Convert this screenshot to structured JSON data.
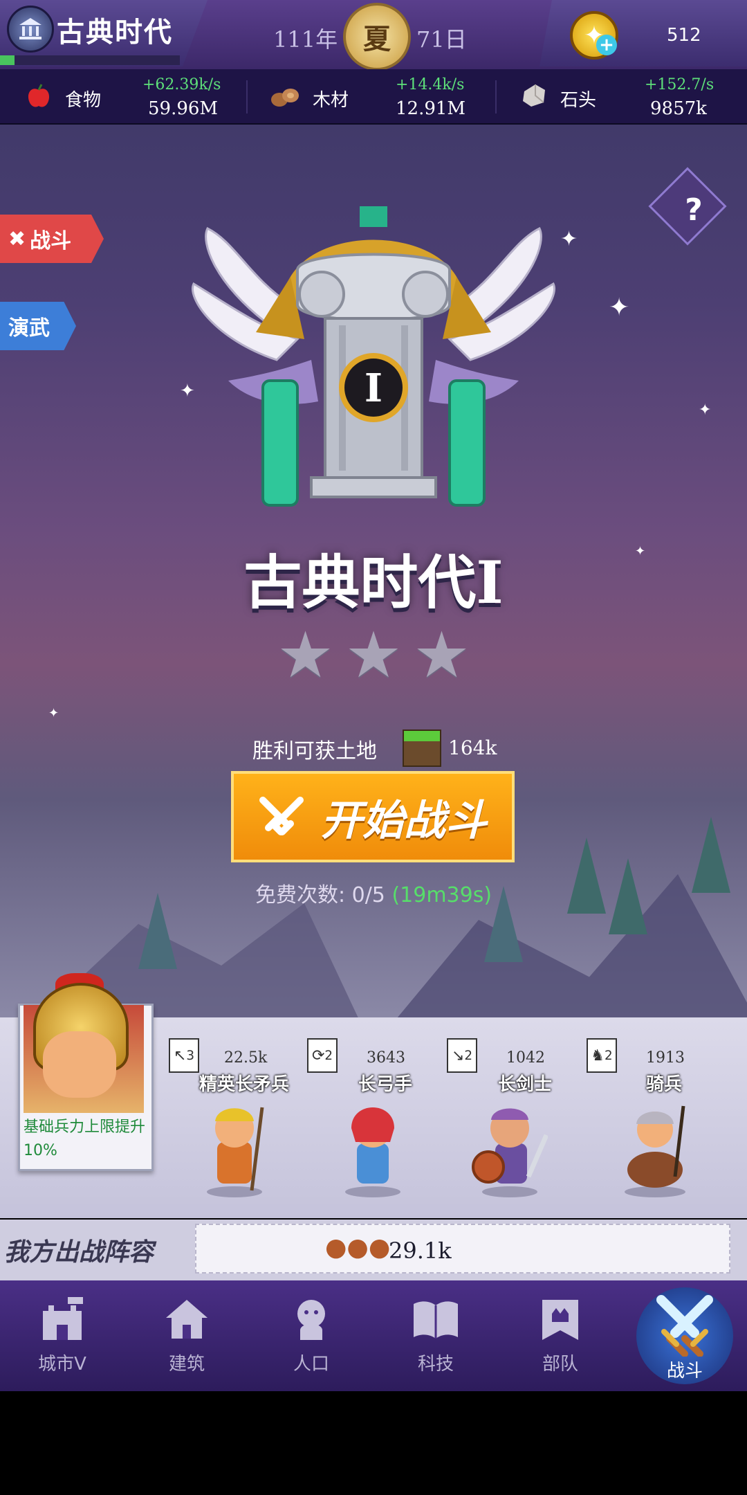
{
  "header": {
    "era_title": "古典时代",
    "year": "111年",
    "season": "夏",
    "day": "71日",
    "gold": "512",
    "era_progress": 0.08
  },
  "resources": [
    {
      "name": "食物",
      "rate": "+62.39k/s",
      "total": "59.96M",
      "icon": "apple-icon"
    },
    {
      "name": "木材",
      "rate": "+14.4k/s",
      "total": "12.91M",
      "icon": "wood-log-icon"
    },
    {
      "name": "石头",
      "rate": "+152.7/s",
      "total": "9857k",
      "icon": "stone-icon"
    }
  ],
  "side_buttons": {
    "battle": "战斗",
    "drill": "演武",
    "help": "?"
  },
  "stage": {
    "emblem_numeral": "I",
    "title": "古典时代I",
    "stars_earned": 0,
    "stars_total": 3,
    "reward_label": "胜利可获土地",
    "reward_value": "164k",
    "start_button": "开始战斗",
    "free_label": "免费次数:",
    "free_count": "0/5",
    "free_timer": "(19m39s)"
  },
  "hero": {
    "bonus_text": "基础兵力上限提升10%"
  },
  "units": [
    {
      "badge": "3",
      "count": "22.5k",
      "name": "精英长矛兵",
      "color": "#d9732c"
    },
    {
      "badge": "2",
      "count": "3643",
      "name": "长弓手",
      "color": "#d8343a"
    },
    {
      "badge": "2",
      "count": "1042",
      "name": "长剑士",
      "color": "#8f5bb0"
    },
    {
      "badge": "2",
      "count": "1913",
      "name": "骑兵",
      "color": "#8a4b2a"
    }
  ],
  "lineup": {
    "label": "我方出战阵容",
    "power": "29.1k"
  },
  "nav": [
    {
      "label": "城市V",
      "icon": "castle-icon"
    },
    {
      "label": "建筑",
      "icon": "house-icon"
    },
    {
      "label": "人口",
      "icon": "person-icon"
    },
    {
      "label": "科技",
      "icon": "book-icon"
    },
    {
      "label": "部队",
      "icon": "banner-icon"
    },
    {
      "label": "战斗",
      "icon": "crossed-swords-icon"
    }
  ],
  "colors": {
    "accent_green": "#5ee07a",
    "start_orange": "#f59a10",
    "battle_red": "#e04848",
    "drill_blue": "#3d7ed8"
  }
}
